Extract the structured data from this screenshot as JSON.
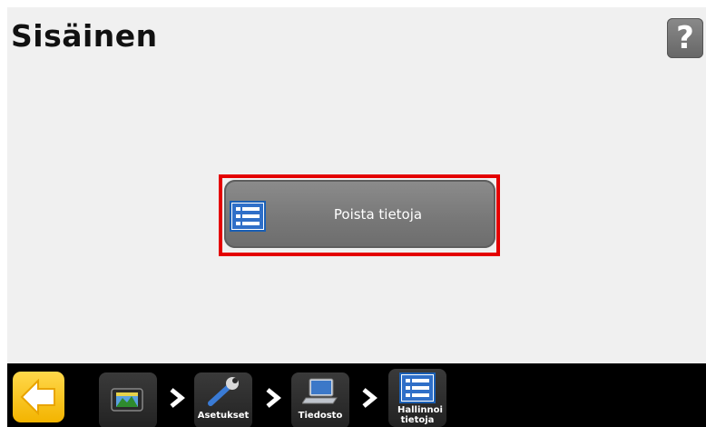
{
  "header": {
    "title": "Sisäinen",
    "help_label": "?"
  },
  "main": {
    "action_button_label": "Poista tietoja",
    "action_icon": "list-icon"
  },
  "bottombar": {
    "back_icon": "arrow-left-icon",
    "breadcrumbs": [
      {
        "label": "",
        "icon": "display-icon"
      },
      {
        "label": "Asetukset",
        "icon": "wrench-icon"
      },
      {
        "label": "Tiedosto",
        "icon": "laptop-icon"
      },
      {
        "label": "Hallinnoi tietoja",
        "icon": "list-icon"
      }
    ]
  },
  "colors": {
    "highlight": "#e40000",
    "back_button": "#f3b400",
    "list_icon_blue": "#1a5fb4"
  }
}
